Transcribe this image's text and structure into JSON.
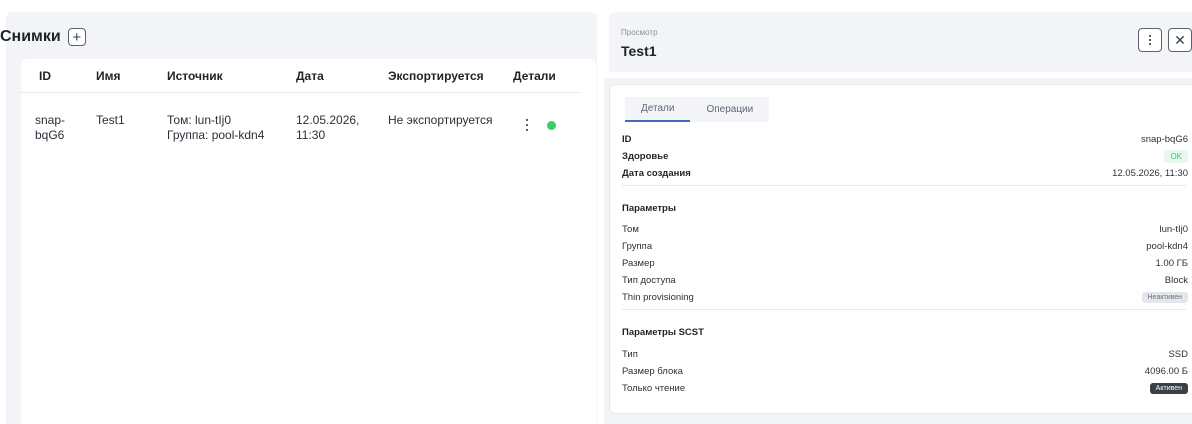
{
  "snapshots": {
    "title": "Снимки",
    "add_icon": "+",
    "columns": [
      "ID",
      "Имя",
      "Источник",
      "Дата",
      "Экспортируется",
      "Детали"
    ],
    "rows": [
      {
        "id_line1": "snap-",
        "id_line2": "bqG6",
        "name": "Test1",
        "source_line1": "Том: lun-tIj0",
        "source_line2": "Группа: pool-kdn4",
        "date_line1": "12.05.2026,",
        "date_line2": "11:30",
        "exported": "Не экспортируется",
        "status_color": "#3ecb68"
      }
    ]
  },
  "detail": {
    "breadcrumb": "Просмотр",
    "title": "Test1",
    "close_icon": "✕",
    "tabs": [
      "Детали",
      "Операции"
    ],
    "active_tab": "Детали",
    "summary": [
      {
        "label": "ID",
        "value": "snap-bqG6"
      },
      {
        "label": "Здоровье",
        "value": "OK"
      },
      {
        "label": "Дата создания",
        "value": "12.05.2026, 11:30"
      }
    ],
    "params_title": "Параметры",
    "params": [
      {
        "label": "Том",
        "value": "lun-tIj0"
      },
      {
        "label": "Группа",
        "value": "pool-kdn4"
      },
      {
        "label": "Размер",
        "value": "1.00 ГБ"
      },
      {
        "label": "Тип доступа",
        "value": "Block"
      },
      {
        "label": "Thin provisioning",
        "value": "Неактивен"
      }
    ],
    "scst_title": "Параметры SCST",
    "scst": [
      {
        "label": "Тип",
        "value": "SSD"
      },
      {
        "label": "Размер блока",
        "value": "4096.00 Б"
      },
      {
        "label": "Только чтение",
        "value": "Активен"
      }
    ]
  },
  "colors": {
    "accent": "#3f6cb8",
    "ok": "#3ecb68",
    "panel_bg": "#f2f4f7"
  }
}
